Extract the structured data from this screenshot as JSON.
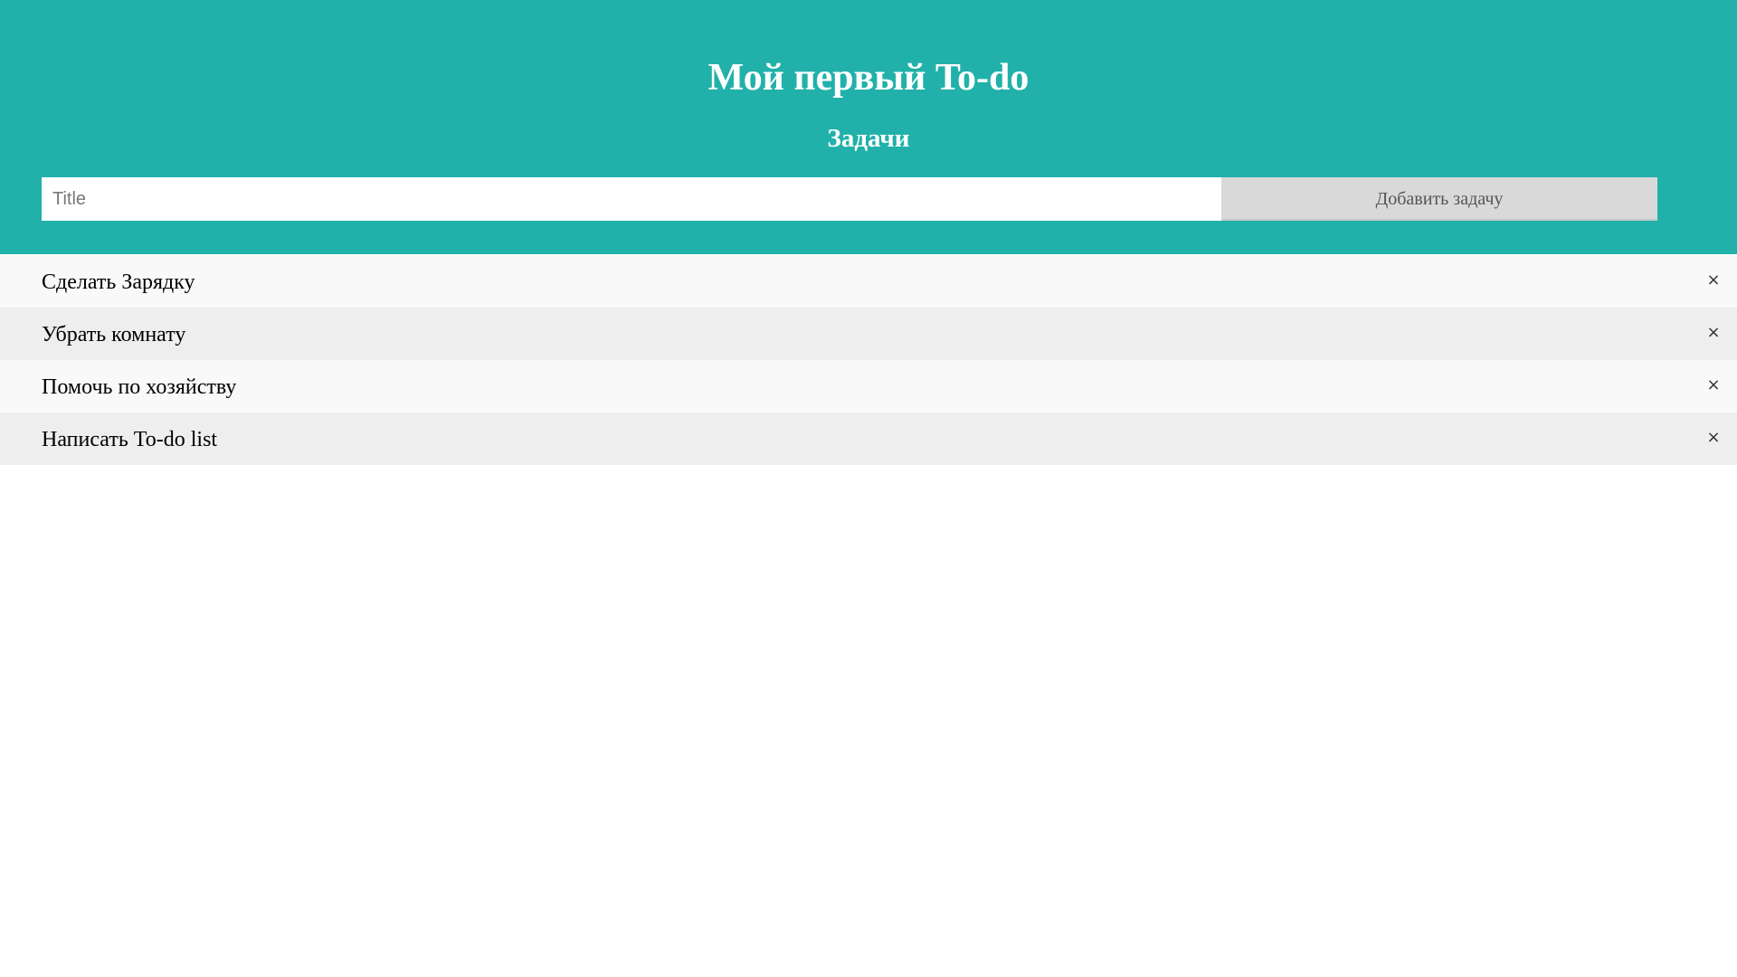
{
  "header": {
    "title": "Мой первый To-do",
    "subtitle": "Задачи",
    "background_color": "#21b1aa"
  },
  "add_form": {
    "input_value": "",
    "input_placeholder": "Title",
    "add_button_label": "Добавить задачу"
  },
  "tasks": [
    {
      "label": "Сделать Зарядку",
      "delete_icon": "close-icon",
      "delete_glyph": "×"
    },
    {
      "label": "Убрать комнату",
      "delete_icon": "close-icon",
      "delete_glyph": "×"
    },
    {
      "label": "Помочь по хозяйству",
      "delete_icon": "close-icon",
      "delete_glyph": "×"
    },
    {
      "label": "Написать To-do list",
      "delete_icon": "close-icon",
      "delete_glyph": "×"
    }
  ],
  "colors": {
    "accent": "#21b1aa",
    "row_light": "#f9f9f9",
    "row_dark": "#eeeeee",
    "button_bg": "#d9d9d9"
  }
}
